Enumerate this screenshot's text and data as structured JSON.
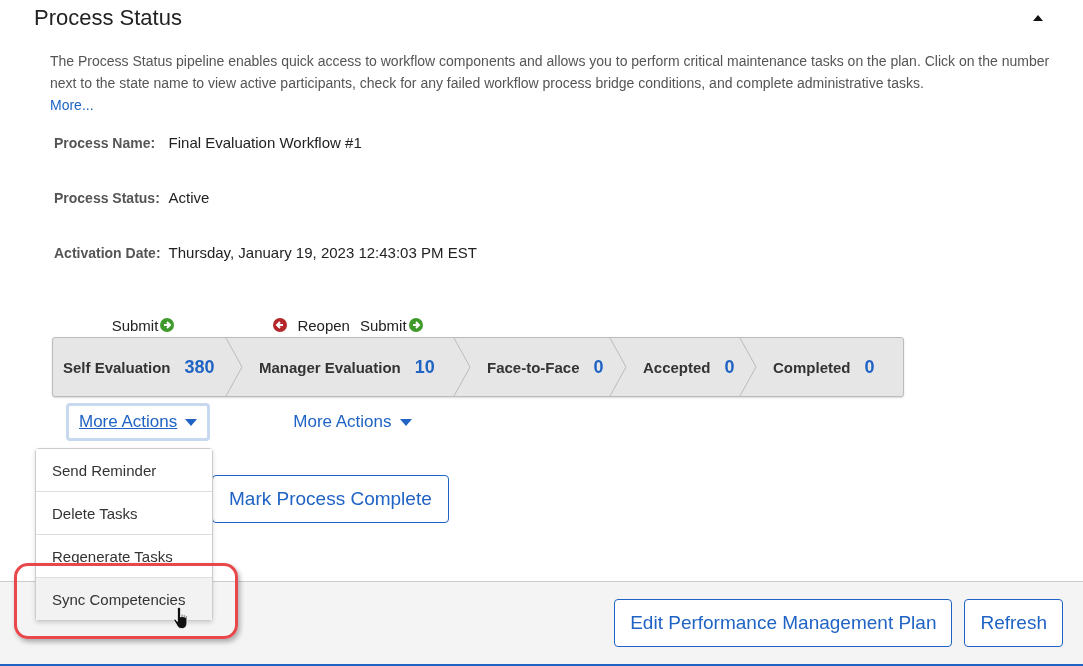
{
  "section": {
    "title": "Process Status",
    "expanded": true
  },
  "description": {
    "text": "The Process Status pipeline enables quick access to workflow components and allows you to perform critical maintenance tasks on the plan. Click on the number next to the state name to view active participants, check for any failed workflow process bridge conditions, and complete administrative tasks.",
    "link": "More..."
  },
  "fields": [
    {
      "label": "Process Name:",
      "value": "Final Evaluation Workflow #1"
    },
    {
      "label": "Process Status:",
      "value": "Active"
    },
    {
      "label": "Activation Date:",
      "value": "Thursday, January 19, 2023 12:43:03 PM EST"
    }
  ],
  "pipeline": [
    {
      "name": "Self Evaluation",
      "count": "380",
      "transitions": [
        {
          "kind": "submit",
          "label": "Submit"
        }
      ]
    },
    {
      "name": "Manager Evaluation",
      "count": "10",
      "transitions": [
        {
          "kind": "reopen",
          "label": "Reopen"
        },
        {
          "kind": "submit",
          "label": "Submit"
        }
      ]
    },
    {
      "name": "Face-to-Face",
      "count": "0"
    },
    {
      "name": "Accepted",
      "count": "0"
    },
    {
      "name": "Completed",
      "count": "0"
    }
  ],
  "more_actions": [
    {
      "label": "More Actions",
      "expanded": true
    },
    {
      "label": "More Actions",
      "expanded": false
    }
  ],
  "menu": [
    {
      "label": "Send Reminder",
      "selected": false
    },
    {
      "label": "Delete Tasks",
      "selected": false
    },
    {
      "label": "Regenerate Tasks",
      "selected": false
    },
    {
      "label": "Sync Competencies",
      "selected": true
    }
  ],
  "mark_complete": "Mark Process Complete",
  "footer_buttons": [
    "Edit Performance Management Plan",
    "Refresh"
  ]
}
